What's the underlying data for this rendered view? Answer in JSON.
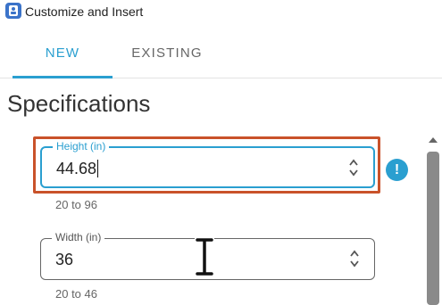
{
  "window": {
    "title": "Customize and Insert",
    "icon": "app-icon"
  },
  "tabs": [
    {
      "label": "NEW",
      "active": true
    },
    {
      "label": "EXISTING",
      "active": false
    }
  ],
  "section": {
    "title": "Specifications"
  },
  "fields": {
    "height": {
      "label": "Height (in)",
      "value": "44.68",
      "hint": "20 to 96",
      "focused": true,
      "warning_icon": "exclamation-icon"
    },
    "width": {
      "label": "Width (in)",
      "value": "36",
      "hint": "20 to 46"
    }
  },
  "colors": {
    "accent": "#2a9fd0",
    "focus_outline": "#c9522a",
    "scroll_thumb": "#8a8a8a"
  },
  "icons": [
    "app-icon",
    "stepper-icon",
    "exclamation-icon",
    "scroll-up-icon",
    "i-beam-cursor-icon"
  ]
}
